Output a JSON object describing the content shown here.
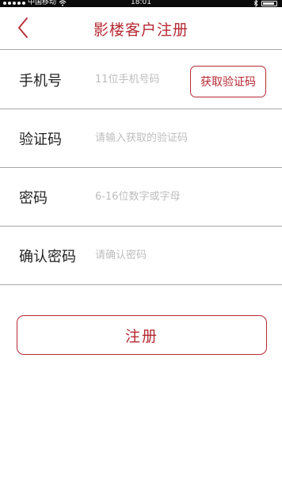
{
  "status_bar": {
    "carrier": "中国移动",
    "time": "18:01"
  },
  "header": {
    "back_icon": "chevron-left-icon",
    "title": "影楼客户注册"
  },
  "form": {
    "phone": {
      "label": "手机号",
      "placeholder": "11位手机号码"
    },
    "get_code_label": "获取验证码",
    "code": {
      "label": "验证码",
      "placeholder": "请输入获取的验证码"
    },
    "password": {
      "label": "密码",
      "placeholder": "6-16位数字或字母"
    },
    "confirm": {
      "label": "确认密码",
      "placeholder": "请确认密码"
    }
  },
  "register_label": "注册",
  "colors": {
    "accent": "#b52a33",
    "divider": "#a9a9a9",
    "placeholder": "#bdbdbd",
    "label": "#222222"
  }
}
